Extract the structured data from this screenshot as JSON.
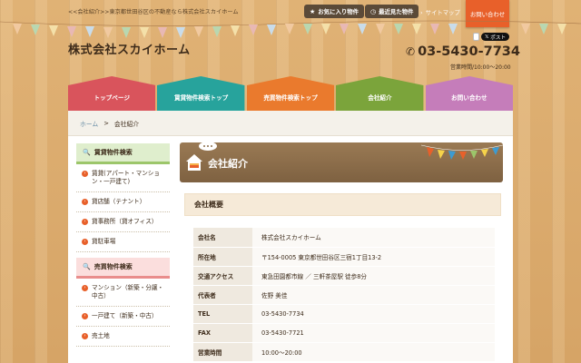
{
  "header": {
    "tagline": "<<会社紹介>>東京都世田谷区の不動産なら株式会社スカイホーム",
    "favorites_label": "お気に入り物件",
    "recent_label": "最近見た物件",
    "sitemap_label": "サイトマップ",
    "contact_tab_label": "お問い合わせ",
    "post_label": "ポスト",
    "site_title": "株式会社スカイホーム",
    "phone": "03-5430-7734",
    "hours": "営業時間/10:00～20:00"
  },
  "nav": {
    "items": [
      {
        "label": "トップページ",
        "color": "#d9545c"
      },
      {
        "label": "賃貸物件検索トップ",
        "color": "#27a39c"
      },
      {
        "label": "売買物件検索トップ",
        "color": "#ea7a2d"
      },
      {
        "label": "会社紹介",
        "color": "#7ba43b"
      },
      {
        "label": "お問い合わせ",
        "color": "#c57dba"
      }
    ]
  },
  "breadcrumb": {
    "home": "ホーム",
    "separator": ">",
    "current": "会社紹介"
  },
  "sidebar": {
    "rental": {
      "title": "賃貸物件検索",
      "items": [
        {
          "label": "賃貸(アパート・マンション・一戸建て)"
        },
        {
          "label": "貸店舗（テナント）"
        },
        {
          "label": "貸事務所（貸オフィス）"
        },
        {
          "label": "貸駐車場"
        }
      ]
    },
    "sale": {
      "title": "売買物件検索",
      "items": [
        {
          "label": "マンション（新築・分譲・中古）"
        },
        {
          "label": "一戸建て（新築・中古）"
        },
        {
          "label": "売土地"
        }
      ]
    }
  },
  "main": {
    "page_title": "会社紹介",
    "section_title": "会社概要",
    "rows": [
      {
        "key": "会社名",
        "value": "株式会社スカイホーム"
      },
      {
        "key": "所在地",
        "value": "〒154-0005 東京都世田谷区三宿1丁目13-2"
      },
      {
        "key": "交通アクセス",
        "value": "東急田園都市線 ／ 三軒茶屋駅 徒歩8分"
      },
      {
        "key": "代表者",
        "value": "佐野 美佳"
      },
      {
        "key": "TEL",
        "value": "03-5430-7734"
      },
      {
        "key": "FAX",
        "value": "03-5430-7721"
      },
      {
        "key": "営業時間",
        "value": "10:00～20:00"
      }
    ]
  },
  "colors": {
    "accent": "#e8602a",
    "wood": "#d6a466",
    "banner": "#8c6e4a"
  }
}
